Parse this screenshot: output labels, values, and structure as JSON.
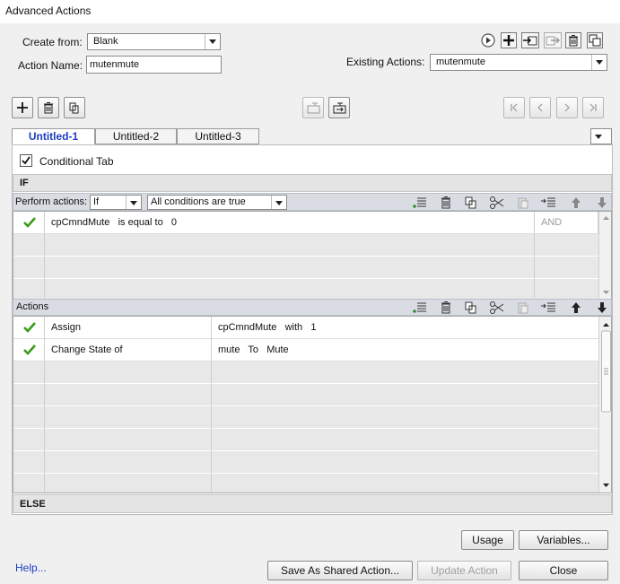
{
  "window": {
    "title": "Advanced Actions"
  },
  "form": {
    "create_from_label": "Create from:",
    "create_from_value": "Blank",
    "action_name_label": "Action Name:",
    "action_name_value": "mutenmute",
    "existing_actions_label": "Existing Actions:",
    "existing_actions_value": "mutenmute"
  },
  "tabs": [
    {
      "label": "Untitled-1",
      "active": true
    },
    {
      "label": "Untitled-2",
      "active": false
    },
    {
      "label": "Untitled-3",
      "active": false
    }
  ],
  "conditional": {
    "label": "Conditional Tab",
    "checked": true
  },
  "if_section": {
    "label": "IF",
    "perform_actions_label": "Perform actions:",
    "perform_value": "If",
    "conditions_value": "All conditions are true",
    "rows": [
      {
        "expression": "cpCmndMute   is equal to   0",
        "joiner": "AND"
      }
    ]
  },
  "actions_section": {
    "label": "Actions",
    "rows": [
      {
        "action": "Assign",
        "detail": "cpCmndMute   with   1"
      },
      {
        "action": "Change State of",
        "detail": "mute   To   Mute"
      }
    ]
  },
  "else_section": {
    "label": "ELSE"
  },
  "buttons": {
    "usage": "Usage",
    "variables": "Variables...",
    "help": "Help...",
    "save_shared": "Save As Shared Action...",
    "update": "Update Action",
    "close": "Close"
  },
  "icons": {
    "check_color": "#3a9a1a",
    "active_tab_color": "#1c3fbf"
  }
}
